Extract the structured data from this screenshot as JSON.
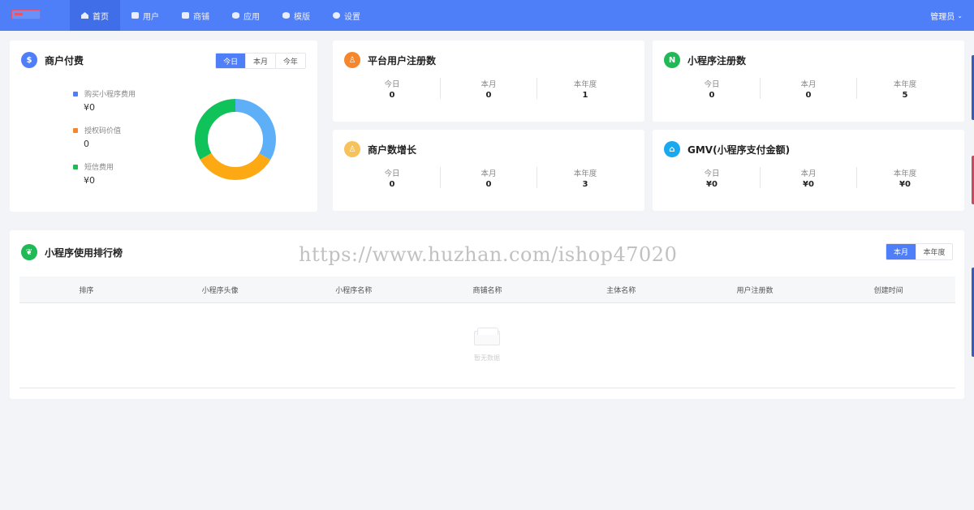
{
  "nav": {
    "items": [
      {
        "label": "首页",
        "icon": "home-icon",
        "active": true
      },
      {
        "label": "用户",
        "icon": "users-icon",
        "active": false
      },
      {
        "label": "商铺",
        "icon": "shop-icon",
        "active": false
      },
      {
        "label": "应用",
        "icon": "apps-icon",
        "active": false
      },
      {
        "label": "模版",
        "icon": "layers-icon",
        "active": false
      },
      {
        "label": "设置",
        "icon": "gear-icon",
        "active": false
      }
    ],
    "admin_label": "管理员",
    "admin_chevron": "⌄"
  },
  "merchant_pay": {
    "title": "商户付费",
    "tabs": [
      "今日",
      "本月",
      "今年"
    ],
    "active_tab": 0,
    "legend": [
      {
        "label": "购买小程序费用",
        "value": "¥0",
        "color": "#4f7ef9"
      },
      {
        "label": "授权码价值",
        "value": "0",
        "color": "#f5862c"
      },
      {
        "label": "短信费用",
        "value": "¥0",
        "color": "#1fb956"
      }
    ],
    "donut": [
      {
        "fraction": 0.3333,
        "color": "#5db0f8"
      },
      {
        "fraction": 0.3333,
        "color": "#fda913"
      },
      {
        "fraction": 0.3334,
        "color": "#10c25a"
      }
    ]
  },
  "cards": [
    {
      "title": "平台用户注册数",
      "icon_color": "#f5862c",
      "icon": "user-icon",
      "icon_glyph": "♙",
      "stats": [
        {
          "label": "今日",
          "value": "0"
        },
        {
          "label": "本月",
          "value": "0"
        },
        {
          "label": "本年度",
          "value": "1"
        }
      ]
    },
    {
      "title": "小程序注册数",
      "icon_color": "#1fb956",
      "icon": "miniprogram-icon",
      "icon_glyph": "N",
      "stats": [
        {
          "label": "今日",
          "value": "0"
        },
        {
          "label": "本月",
          "value": "0"
        },
        {
          "label": "本年度",
          "value": "5"
        }
      ]
    },
    {
      "title": "商户数增长",
      "icon_color": "#f6c25b",
      "icon": "merchant-icon",
      "icon_glyph": "♙",
      "stats": [
        {
          "label": "今日",
          "value": "0"
        },
        {
          "label": "本月",
          "value": "0"
        },
        {
          "label": "本年度",
          "value": "3"
        }
      ]
    },
    {
      "title": "GMV(小程序支付金额)",
      "icon_color": "#18a9ee",
      "icon": "house-icon",
      "icon_glyph": "⌂",
      "stats": [
        {
          "label": "今日",
          "value": "¥0"
        },
        {
          "label": "本月",
          "value": "¥0"
        },
        {
          "label": "本年度",
          "value": "¥0"
        }
      ]
    }
  ],
  "ranking": {
    "title": "小程序使用排行榜",
    "tabs": [
      "本月",
      "本年度"
    ],
    "active_tab": 0,
    "columns": [
      "排序",
      "小程序头像",
      "小程序名称",
      "商铺名称",
      "主体名称",
      "用户注册数",
      "创建时间"
    ],
    "empty_text": "暂无数据"
  },
  "watermark": "https://www.huzhan.com/ishop47020"
}
